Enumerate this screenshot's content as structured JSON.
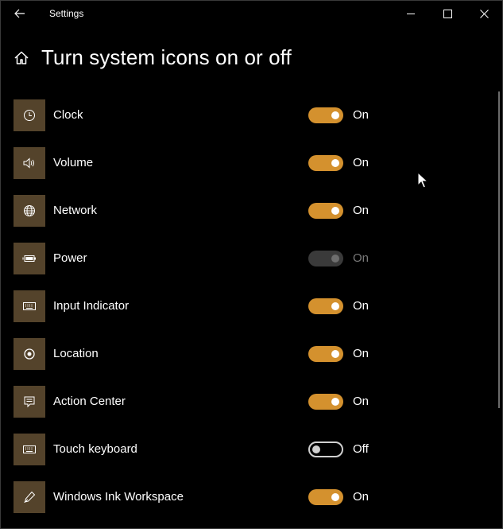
{
  "window": {
    "title": "Settings"
  },
  "page": {
    "title": "Turn system icons on or off"
  },
  "accent": "#d4912e",
  "items": [
    {
      "label": "Clock",
      "icon": "clock-icon",
      "state": "On",
      "toggle": "on"
    },
    {
      "label": "Volume",
      "icon": "volume-icon",
      "state": "On",
      "toggle": "on"
    },
    {
      "label": "Network",
      "icon": "globe-icon",
      "state": "On",
      "toggle": "on"
    },
    {
      "label": "Power",
      "icon": "battery-icon",
      "state": "On",
      "toggle": "disabled"
    },
    {
      "label": "Input Indicator",
      "icon": "keyboard-icon",
      "state": "On",
      "toggle": "on"
    },
    {
      "label": "Location",
      "icon": "location-icon",
      "state": "On",
      "toggle": "on"
    },
    {
      "label": "Action Center",
      "icon": "action-center-icon",
      "state": "On",
      "toggle": "on"
    },
    {
      "label": "Touch keyboard",
      "icon": "keyboard-icon",
      "state": "Off",
      "toggle": "off"
    },
    {
      "label": "Windows Ink Workspace",
      "icon": "pen-icon",
      "state": "On",
      "toggle": "on"
    }
  ]
}
